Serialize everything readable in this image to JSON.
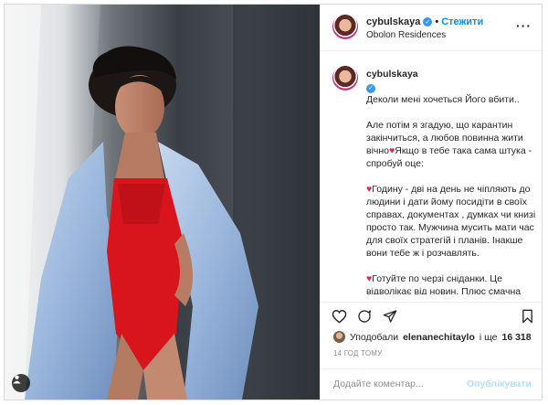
{
  "post": {
    "header": {
      "username": "cybulskaya",
      "follow_label": "Стежити",
      "location": "Obolon Residences",
      "more_label": "···"
    },
    "caption": {
      "username": "cybulskaya",
      "intro": "Деколи мені хочеться Його вбити..",
      "p1": "Але потім я згадую, що карантин закінчиться, а любов повинна жити вічно",
      "p1b": "Якщо в тебе така сама штука - спробуй оце:",
      "p2": "Годину - дві на день не чіпляють до людини і дати йому посидіти в своїх справах, документах , думках чи книзі просто так. Мужчина мусить мати час для своїх стратегій і планів. Інакше вони тебе ж і розчавлять.",
      "p3": "Готуйте по черзі сніданки. Це відволікає від новин. Плюс смачна домашня їжа і секс- синоніми",
      "heart_glyph": "♥",
      "emoji_grin": "😄",
      "emoji_lips": "👄"
    },
    "likes": {
      "prefix": "Уподобали",
      "user": "elenanechitaylo",
      "middle": "і ще",
      "count": "16 318"
    },
    "time_ago": "14 ГОД ТОМУ",
    "comment": {
      "placeholder": "Додайте коментар...",
      "publish_label": "Опублікувати"
    },
    "icons": {
      "like": "heart-outline-icon",
      "comment": "comment-icon",
      "share": "paper-plane-icon",
      "save": "bookmark-icon",
      "verified": "verified-badge-icon",
      "tagged": "user-tag-icon"
    },
    "colors": {
      "accent": "#0095f6",
      "publish_disabled": "#b2dffc",
      "verified": "#3897f0",
      "heart": "#e0245e",
      "outfit_red": "#d8141c",
      "robe_blue": "#aac3e3"
    }
  }
}
